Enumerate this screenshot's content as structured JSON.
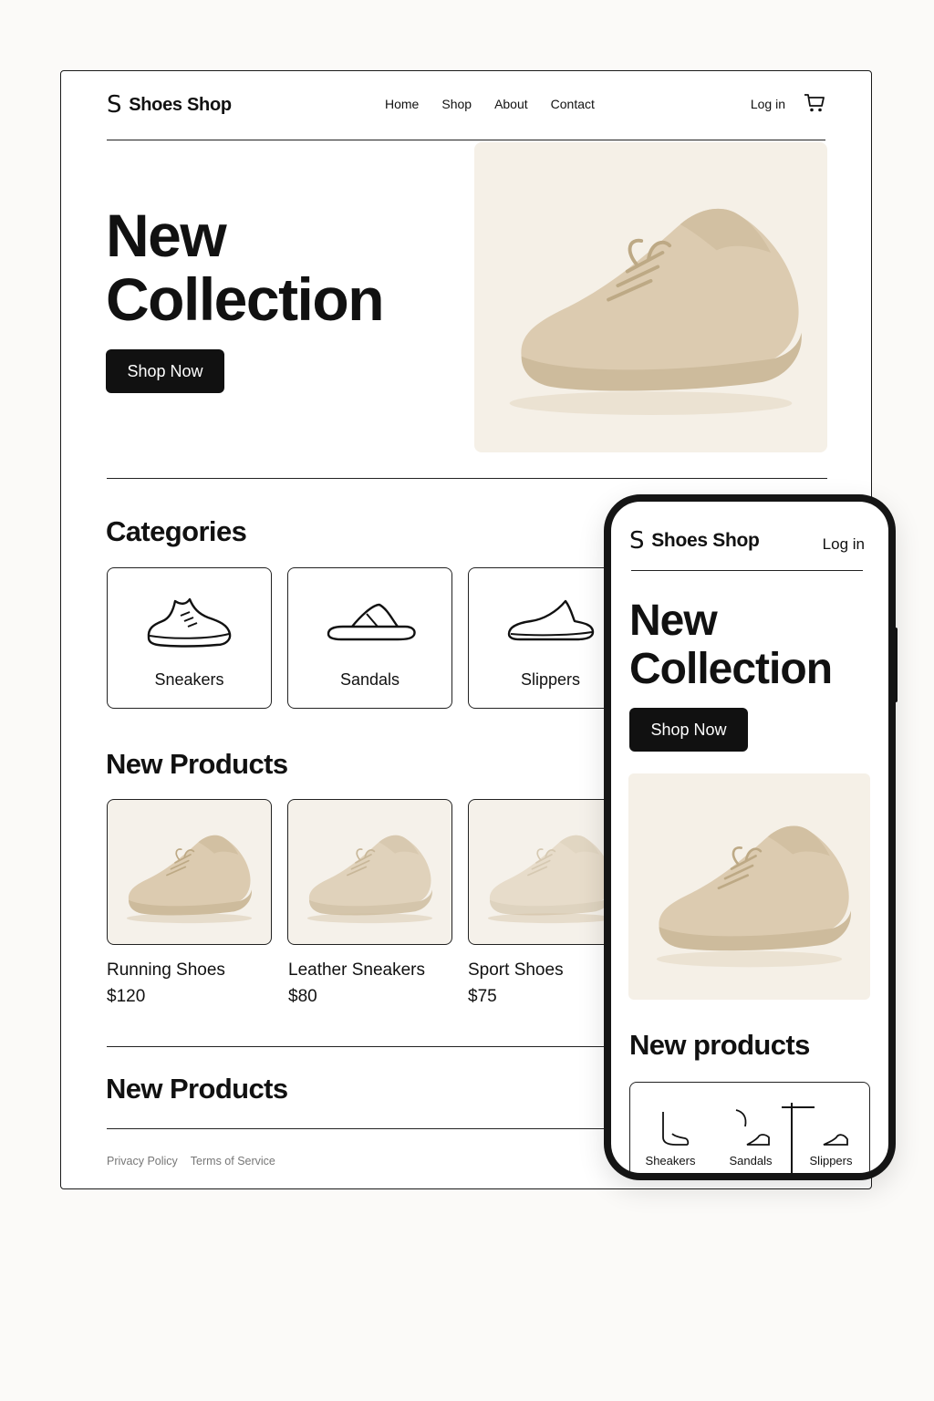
{
  "desktop": {
    "brand": {
      "logo_letter": "S",
      "name": "Shoes Shop"
    },
    "nav": [
      "Home",
      "Shop",
      "About",
      "Contact"
    ],
    "login_label": "Log in",
    "hero": {
      "title_line1": "New",
      "title_line2": "Collection",
      "cta_label": "Shop Now"
    },
    "categories": {
      "title": "Categories",
      "items": [
        {
          "label": "Sneakers",
          "icon": "sneaker-icon"
        },
        {
          "label": "Sandals",
          "icon": "sandal-icon"
        },
        {
          "label": "Slippers",
          "icon": "slipper-icon"
        }
      ]
    },
    "new_products": {
      "title": "New Products",
      "items": [
        {
          "name": "Running Shoes",
          "price": "$120"
        },
        {
          "name": "Leather Sneakers",
          "price": "$80"
        },
        {
          "name": "Sport Shoes",
          "price": "$75"
        }
      ]
    },
    "second_section_title": "New Products",
    "footer": {
      "privacy": "Privacy Policy",
      "terms": "Terms of Service"
    }
  },
  "mobile": {
    "brand": {
      "logo_letter": "S",
      "name": "Shoes Shop"
    },
    "login_label": "Log in",
    "hero": {
      "title_line1": "New",
      "title_line2": "Collection",
      "cta_label": "Shop Now"
    },
    "section_title": "New products",
    "categories": [
      {
        "label": "Sheakers",
        "icon": "sneaker-icon"
      },
      {
        "label": "Sandals",
        "icon": "sandal-icon"
      },
      {
        "label": "Slippers",
        "icon": "slipper-icon"
      }
    ]
  },
  "colors": {
    "text": "#111111",
    "background": "#fbfaf8",
    "card": "#ffffff",
    "beige": "#d9c9ad",
    "image_bg": "#f5f0e7"
  }
}
